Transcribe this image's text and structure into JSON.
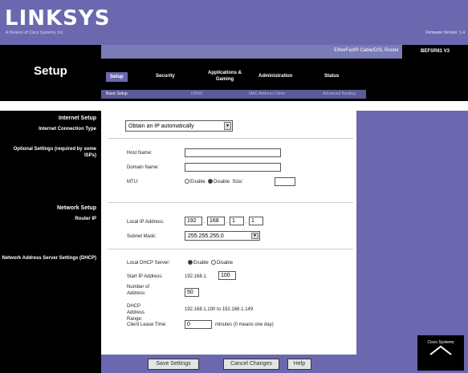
{
  "brand": {
    "logo": "LINKSYS",
    "tagline": "A Division of Cisco Systems, Inc.",
    "firmware": "Firmware Version: 1.4"
  },
  "product": {
    "name": "EtherFast® Cable/DSL Router",
    "model": "BEFSR81 V3"
  },
  "page_title": "Setup",
  "tabs": [
    "Setup",
    "Security",
    "Applications & Gaming",
    "Administration",
    "Status"
  ],
  "subtabs": [
    "Basic Setup",
    "DDNS",
    "MAC Address Clone",
    "Advanced Routing"
  ],
  "sections": {
    "internet": {
      "header": "Internet Setup",
      "conn_type_label": "Internet Connection Type",
      "optional_label": "Optional Settings (required by some ISPs)"
    },
    "network": {
      "header": "Network Setup",
      "router_ip_label": "Router IP",
      "dhcp_label": "Network Address Server Settings (DHCP)"
    }
  },
  "form": {
    "connection_type": "Obtain an IP automatically",
    "host_name_label": "Host Name:",
    "host_name": "",
    "domain_name_label": "Domain Name:",
    "domain_name": "",
    "mtu_label": "MTU:",
    "mtu_enable": "Enable",
    "mtu_disable": "Disable",
    "mtu_size_label": "Size:",
    "mtu_size": "",
    "local_ip_label": "Local IP Address:",
    "local_ip": [
      "192",
      "168",
      "1",
      "1"
    ],
    "subnet_label": "Subnet Mask:",
    "subnet": "255.255.255.0",
    "dhcp_label": "Local DHCP Server:",
    "dhcp_enable": "Enable",
    "dhcp_disable": "Disable",
    "start_ip_label": "Start IP Address:",
    "start_ip_prefix": "192.168.1.",
    "start_ip": "100",
    "num_addr_label": "Number of Address:",
    "num_addr": "50",
    "range_label": "DHCP Address Range:",
    "range": "192.168.1.100 to 192.168.1.149",
    "lease_label": "Client Lease Time:",
    "lease": "0",
    "lease_unit": "minutes (0 means one day)"
  },
  "buttons": {
    "save": "Save Settings",
    "cancel": "Cancel Changes",
    "help": "Help"
  },
  "cisco": "Cisco Systems"
}
